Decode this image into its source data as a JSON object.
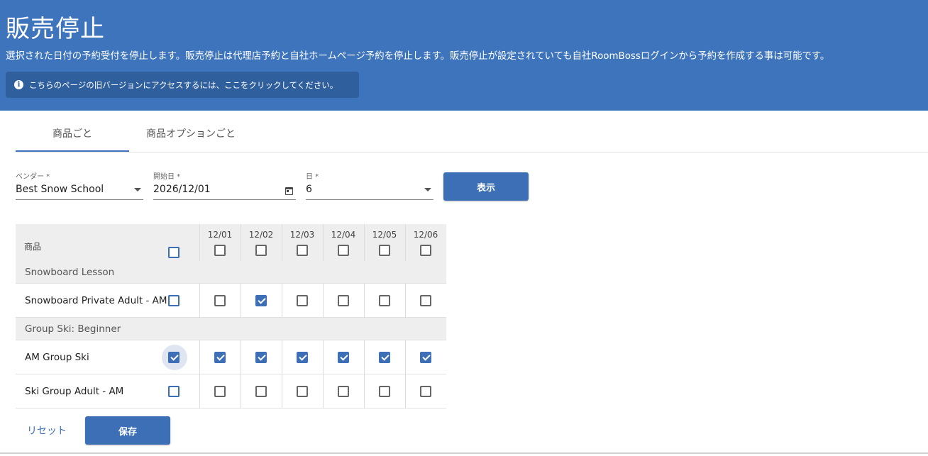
{
  "header": {
    "title": "販売停止",
    "description": "選択された日付の予約受付を停止します。販売停止は代理店予約と自社ホームページ予約を停止します。販売停止が設定されていても自社RoomBossログインから予約を作成する事は可能です。",
    "legacy_banner": "こちらのページの旧バージョンにアクセスするには、ここをクリックしてください。",
    "info_icon_glyph": "i"
  },
  "tabs": [
    {
      "label": "商品ごと",
      "active": true
    },
    {
      "label": "商品オプションごと",
      "active": false
    }
  ],
  "filters": {
    "vendor": {
      "label": "ベンダー *",
      "value": "Best Snow School"
    },
    "start_date": {
      "label": "開始日 *",
      "value": "2026/12/01"
    },
    "days": {
      "label": "日 *",
      "value": "6"
    },
    "show_button": "表示"
  },
  "grid": {
    "product_header": "商品",
    "dates": [
      "12/01",
      "12/02",
      "12/03",
      "12/04",
      "12/05",
      "12/06"
    ],
    "header_all": false,
    "header_dates": [
      false,
      false,
      false,
      false,
      false,
      false
    ],
    "rows": [
      {
        "type": "group",
        "label": "Snowboard Lesson"
      },
      {
        "type": "item",
        "label": "Snowboard Private Adult - AM",
        "all": false,
        "days": [
          false,
          true,
          false,
          false,
          false,
          false
        ]
      },
      {
        "type": "group",
        "label": "Group Ski: Beginner"
      },
      {
        "type": "item",
        "label": "AM Group Ski",
        "all": true,
        "focused": true,
        "days": [
          true,
          true,
          true,
          true,
          true,
          true
        ]
      },
      {
        "type": "item",
        "label": "Ski Group Adult - AM",
        "all": false,
        "days": [
          false,
          false,
          false,
          false,
          false,
          false
        ]
      }
    ]
  },
  "footer": {
    "reset_label": "リセット",
    "save_label": "保存"
  },
  "colors": {
    "header_bg": "#3d74bc",
    "primary": "#3d6fb6"
  }
}
